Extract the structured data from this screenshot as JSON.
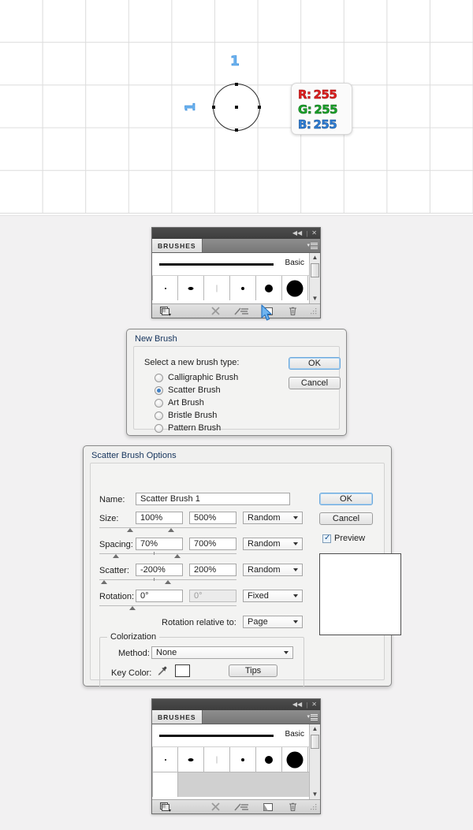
{
  "canvas": {
    "measure_labels": [
      "1",
      "1"
    ],
    "rgb_readout": {
      "r_label": "R:",
      "r_value": "255",
      "g_label": "G:",
      "g_value": "255",
      "b_label": "B:",
      "b_value": "255",
      "r_color": "#e02020",
      "g_color": "#1aa52a",
      "b_color": "#2f7fd8"
    }
  },
  "brushes_panel_top": {
    "tab_label": "BRUSHES",
    "collapse_icon": "◀◀",
    "close_icon": "✕",
    "menu_icon": "panel-menu-icon",
    "stroke_label": "Basic",
    "brush_cells": [
      {
        "name": "brush-dot-1",
        "size": 2
      },
      {
        "name": "brush-blob-2",
        "size": 6
      },
      {
        "name": "brush-line-3",
        "size": 1
      },
      {
        "name": "brush-dot-4",
        "size": 4
      },
      {
        "name": "brush-circle-5",
        "size": 10
      },
      {
        "name": "brush-circle-6",
        "size": 20
      }
    ],
    "footer_icons": [
      {
        "name": "brush-libraries-icon",
        "glyph": "▤"
      },
      {
        "name": "remove-brush-stroke-icon",
        "glyph": "✕"
      },
      {
        "name": "brush-options-icon",
        "glyph": "∕≡"
      },
      {
        "name": "new-brush-icon",
        "glyph": "◳"
      },
      {
        "name": "delete-brush-icon",
        "glyph": "Ὕ1"
      }
    ]
  },
  "new_brush_dialog": {
    "title": "New Brush",
    "prompt": "Select a new brush type:",
    "options": [
      {
        "label": "Calligraphic Brush",
        "selected": false
      },
      {
        "label": "Scatter Brush",
        "selected": true
      },
      {
        "label": "Art Brush",
        "selected": false
      },
      {
        "label": "Bristle Brush",
        "selected": false
      },
      {
        "label": "Pattern Brush",
        "selected": false
      }
    ],
    "ok_label": "OK",
    "cancel_label": "Cancel"
  },
  "scatter_dialog": {
    "title": "Scatter Brush Options",
    "name_label": "Name:",
    "name_value": "Scatter Brush 1",
    "rows": [
      {
        "label": "Size:",
        "min": "100%",
        "max": "500%",
        "mode": "Random"
      },
      {
        "label": "Spacing:",
        "min": "70%",
        "max": "700%",
        "mode": "Random"
      },
      {
        "label": "Scatter:",
        "min": "-200%",
        "max": "200%",
        "mode": "Random"
      },
      {
        "label": "Rotation:",
        "min": "0°",
        "max": "0°",
        "mode": "Fixed"
      }
    ],
    "rotation_relative_label": "Rotation relative to:",
    "rotation_relative_value": "Page",
    "colorization_title": "Colorization",
    "method_label": "Method:",
    "method_value": "None",
    "key_color_label": "Key Color:",
    "eyedropper_icon": "eyedropper-icon",
    "key_color_swatch": "#ffffff",
    "tips_label": "Tips",
    "ok_label": "OK",
    "cancel_label": "Cancel",
    "preview_label": "Preview",
    "preview_checked": true
  },
  "brushes_panel_bottom": {
    "tab_label": "BRUSHES",
    "collapse_icon": "◀◀",
    "close_icon": "✕",
    "stroke_label": "Basic",
    "brush_cells": [
      {
        "name": "brush-dot-1",
        "size": 2
      },
      {
        "name": "brush-blob-2",
        "size": 6
      },
      {
        "name": "brush-line-3",
        "size": 1
      },
      {
        "name": "brush-dot-4",
        "size": 4
      },
      {
        "name": "brush-circle-5",
        "size": 10
      },
      {
        "name": "brush-circle-6",
        "size": 20
      }
    ],
    "new_brush_cell_name": "scatter-brush-1-thumbnail"
  }
}
